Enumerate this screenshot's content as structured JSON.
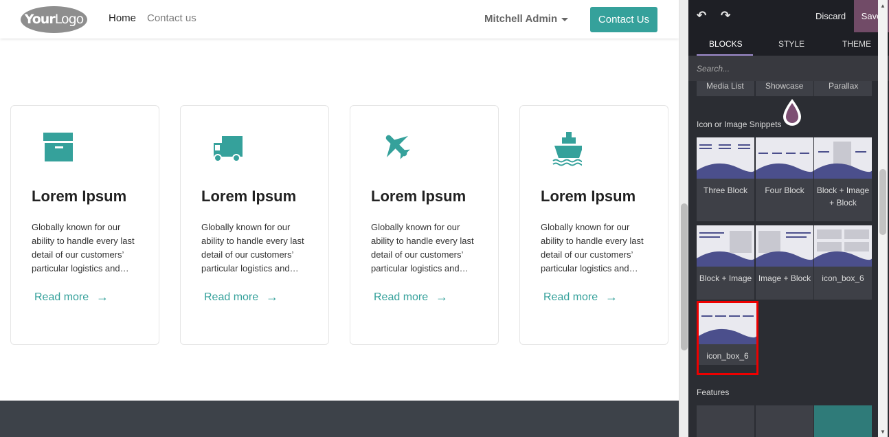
{
  "navbar": {
    "logo_text": "YourLogo",
    "logo_bold": "Your",
    "logo_thin": "Logo",
    "links": [
      "Home",
      "Contact us"
    ],
    "user": "Mitchell Admin",
    "cta": "Contact Us"
  },
  "cards": [
    {
      "icon": "archive-box-icon",
      "title": "Lorem Ipsum",
      "desc": "Globally known for our ability to handle every last detail of our customers’ particular logistics and…",
      "link": "Read more",
      "arrow": "→"
    },
    {
      "icon": "truck-icon",
      "title": "Lorem Ipsum",
      "desc": "Globally known for our ability to handle every last detail of our customers’ particular logistics and…",
      "link": "Read more",
      "arrow": "→"
    },
    {
      "icon": "airplane-icon",
      "title": "Lorem Ipsum",
      "desc": "Globally known for our ability to handle every last detail of our customers’ particular logistics and…",
      "link": "Read more",
      "arrow": "→"
    },
    {
      "icon": "ship-icon",
      "title": "Lorem Ipsum",
      "desc": "Globally known for our ability to handle every last detail of our customers’ particular logistics and…",
      "link": "Read more",
      "arrow": "→"
    }
  ],
  "editor": {
    "discard": "Discard",
    "save": "Save",
    "tabs": [
      "BLOCKS",
      "STYLE",
      "THEME"
    ],
    "search_placeholder": "Search...",
    "prev_row": [
      "Media List",
      "Showcase",
      "Parallax"
    ],
    "section_icon_image": "Icon or Image Snippets",
    "snippets": [
      "Three Block",
      "Four Block",
      "Block + Image + Block",
      "Block + Image",
      "Image + Block",
      "icon_box_6",
      "icon_box_6"
    ],
    "section_features": "Features"
  },
  "colors": {
    "accent": "#35a19b",
    "editor_bg": "#2b2d33",
    "save": "#714b67",
    "highlight": "#e00000"
  }
}
